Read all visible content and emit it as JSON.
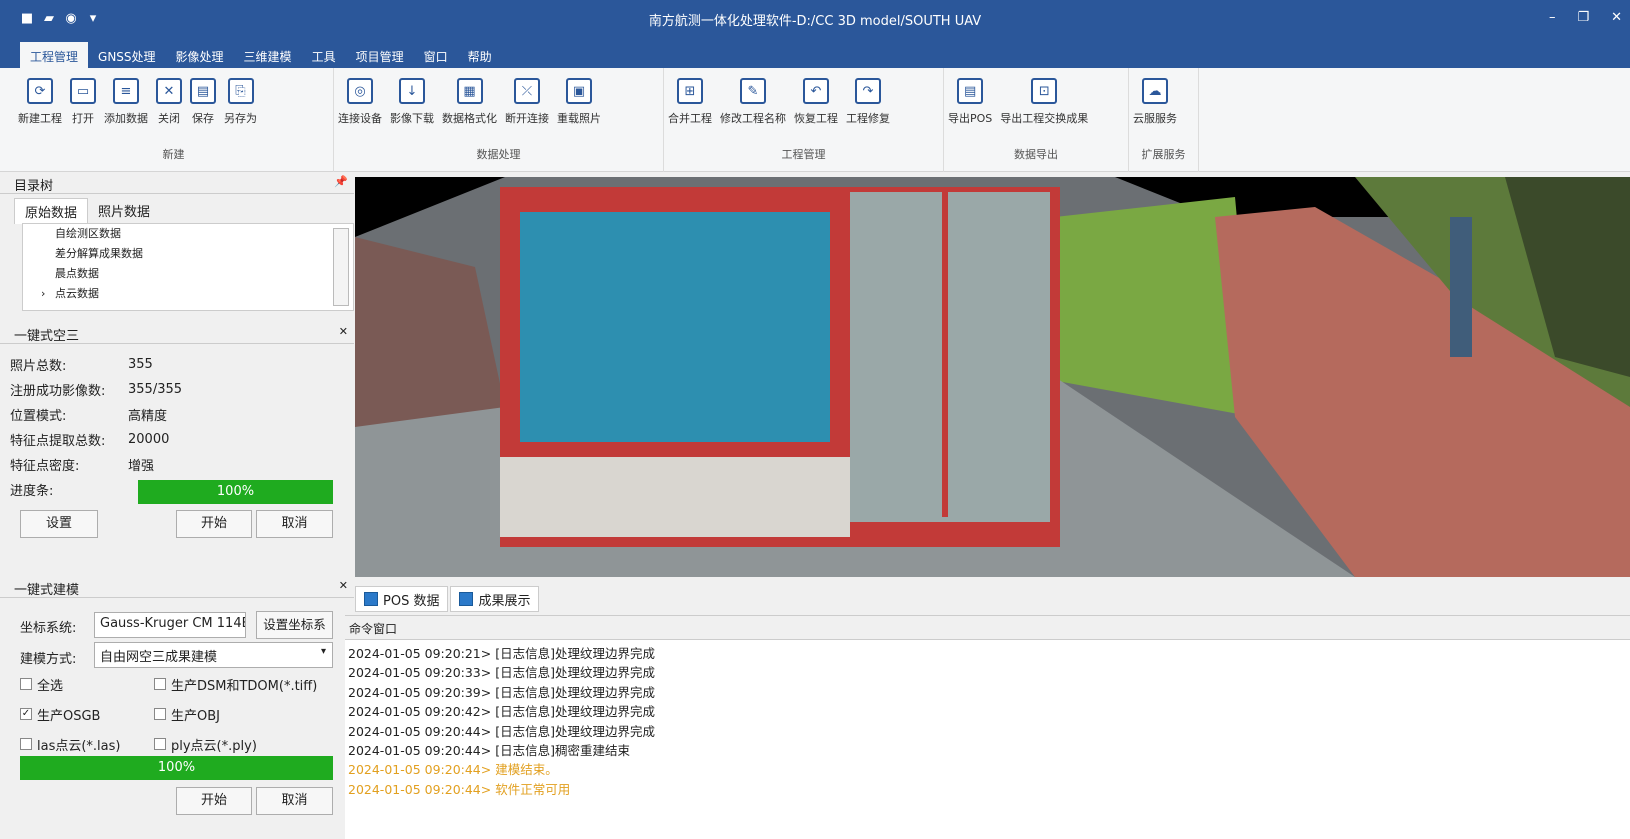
{
  "titlebar": {
    "title": "南方航测一体化处理软件-D:/CC 3D model/SOUTH UAV",
    "min": "–",
    "max": "❐",
    "close": "✕"
  },
  "menu": [
    "工程管理",
    "GNSS处理",
    "影像处理",
    "三维建模",
    "工具",
    "项目管理",
    "窗口",
    "帮助"
  ],
  "ribbon": {
    "groups": [
      {
        "label": "新建",
        "buttons": [
          "新建工程",
          "打开",
          "添加数据",
          "关闭",
          "保存",
          "另存为"
        ]
      },
      {
        "label": "数据处理",
        "buttons": [
          "连接设备",
          "影像下载",
          "数据格式化",
          "断开连接",
          "重载照片"
        ]
      },
      {
        "label": "工程管理",
        "buttons": [
          "合并工程",
          "修改工程名称",
          "恢复工程",
          "工程修复"
        ]
      },
      {
        "label": "数据导出",
        "buttons": [
          "导出POS",
          "导出工程交换成果"
        ]
      },
      {
        "label": "扩展服务",
        "buttons": [
          "云服服务"
        ]
      }
    ]
  },
  "tree": {
    "title": "目录树",
    "tabs": [
      "原始数据",
      "照片数据"
    ],
    "items": [
      "自绘测区数据",
      "差分解算成果数据",
      "晨点数据",
      "点云数据"
    ]
  },
  "aat": {
    "title": "一键式空三",
    "rows": [
      {
        "k": "照片总数:",
        "v": "355"
      },
      {
        "k": "注册成功影像数:",
        "v": "355/355"
      },
      {
        "k": "位置模式:",
        "v": "高精度"
      },
      {
        "k": "特征点提取总数:",
        "v": "20000"
      },
      {
        "k": "特征点密度:",
        "v": "增强"
      }
    ],
    "progress_label": "进度条:",
    "progress": "100%",
    "settings": "设置",
    "start": "开始",
    "cancel": "取消"
  },
  "model": {
    "title": "一键式建模",
    "coord_label": "坐标系统:",
    "coord_value": "Gauss-Kruger CM 114E",
    "coord_btn": "设置坐标系",
    "method_label": "建模方式:",
    "method_value": "自由网空三成果建模",
    "checks": [
      {
        "label": "全选",
        "checked": false
      },
      {
        "label": "生产DSM和TDOM(*.tiff)",
        "checked": false
      },
      {
        "label": "生产OSGB",
        "checked": true
      },
      {
        "label": "生产OBJ",
        "checked": false
      },
      {
        "label": "las点云(*.las)",
        "checked": false
      },
      {
        "label": "ply点云(*.ply)",
        "checked": false
      }
    ],
    "progress": "100%",
    "start": "开始",
    "cancel": "取消"
  },
  "doctabs": [
    "POS 数据",
    "成果展示"
  ],
  "console": {
    "title": "命令窗口",
    "lines": [
      {
        "t": "2024-01-05 09:20:21> [日志信息]处理纹理边界完成",
        "warn": false
      },
      {
        "t": "2024-01-05 09:20:33> [日志信息]处理纹理边界完成",
        "warn": false
      },
      {
        "t": "2024-01-05 09:20:39> [日志信息]处理纹理边界完成",
        "warn": false
      },
      {
        "t": "2024-01-05 09:20:42> [日志信息]处理纹理边界完成",
        "warn": false
      },
      {
        "t": "2024-01-05 09:20:44> [日志信息]处理纹理边界完成",
        "warn": false
      },
      {
        "t": "2024-01-05 09:20:44> [日志信息]稠密重建结束",
        "warn": false
      },
      {
        "t": "2024-01-05 09:20:44> 建模结束。",
        "warn": true
      },
      {
        "t": "2024-01-05 09:20:44> 软件正常可用",
        "warn": true
      }
    ]
  }
}
